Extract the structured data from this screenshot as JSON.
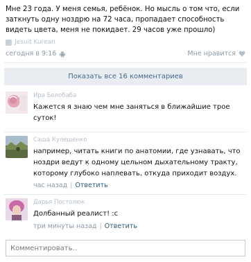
{
  "post": {
    "text": "Мне 23 года. У меня семья, ребёнок. Но мысль о том что, если заткнуть одну ноздрю на 72 часа, пропадает способность видеть цвета, меня не покидает. 29 часов уже прошло)",
    "author": "Jesuit Kurean",
    "time": "сегодня в 9:16",
    "like_label": "Мне нравится"
  },
  "show_all_label": "Показать все 16 комментариев",
  "comments": [
    {
      "author": "Ира Белобаба",
      "text": "Кажется я знаю чем мне заняться в ближайшие трое суток!"
    },
    {
      "author": "Саша Кулешенко",
      "text": "например, читать книги по анатомии, где узнавать, что ноздри ведут к одному цельном дыхательному тракту, которому глубоко наплевать, откуда приходит воздух.",
      "time": "час назад",
      "reply_label": "Ответить"
    },
    {
      "author": "Дарья Постолюк",
      "text": "Долбанный реалист! :c",
      "time": "три минуты назад",
      "reply_label": "Ответить"
    }
  ],
  "comment_input": {
    "placeholder": "Комментировать.."
  },
  "colors": {
    "link": "#2b587a",
    "button_bg": "#e9edf2",
    "button_text": "#45688e",
    "muted": "#8d99a8"
  }
}
